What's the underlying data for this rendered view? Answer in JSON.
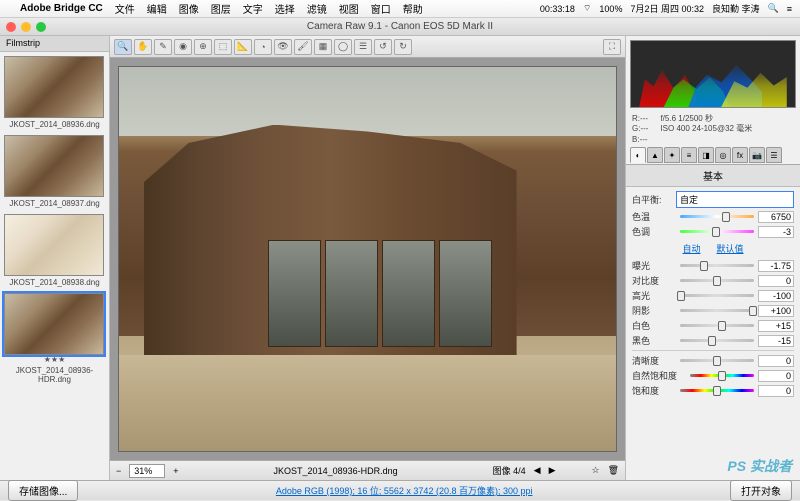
{
  "menubar": {
    "app": "Adobe Bridge CC",
    "items": [
      "文件",
      "编辑",
      "图像",
      "图层",
      "文字",
      "选择",
      "滤镜",
      "视图",
      "窗口",
      "帮助"
    ],
    "right": {
      "progress": "00:33:18",
      "battery": "100%",
      "date": "7月2日 周四 00:32",
      "user": "良知勤 李涛"
    }
  },
  "titlebar": {
    "title": "Camera Raw 9.1 - Canon EOS 5D Mark II"
  },
  "filmstrip": {
    "header": "Filmstrip",
    "thumbs": [
      {
        "label": "JKOST_2014_08936.dng"
      },
      {
        "label": "JKOST_2014_08937.dng"
      },
      {
        "label": "JKOST_2014_08938.dng"
      },
      {
        "label": "JKOST_2014_08936-HDR.dng",
        "stars": "★★★",
        "selected": true
      }
    ]
  },
  "toolbar": {
    "tools": [
      "zoom",
      "hand",
      "eyedrop",
      "sample",
      "crop",
      "straighten",
      "spot",
      "redeye",
      "adjust",
      "brush",
      "grad",
      "radial",
      "prefs",
      "rotate-l",
      "rotate-r"
    ]
  },
  "status": {
    "zoom": "31%",
    "filename": "JKOST_2014_08936-HDR.dng",
    "image_count": "图像 4/4"
  },
  "exif": {
    "r": "---",
    "g": "---",
    "b": "---",
    "aperture": "f/5.6",
    "shutter": "1/2500 秒",
    "iso": "ISO 400",
    "lens": "24-105@32 毫米"
  },
  "basic": {
    "title": "基本",
    "wb_label": "白平衡:",
    "wb_value": "自定",
    "temp_label": "色温",
    "temp_value": "6750",
    "tint_label": "色调",
    "tint_value": "-3",
    "auto": "自动",
    "default": "默认值",
    "exposure_label": "曝光",
    "exposure_value": "-1.75",
    "contrast_label": "对比度",
    "contrast_value": "0",
    "highlights_label": "高光",
    "highlights_value": "-100",
    "shadows_label": "阴影",
    "shadows_value": "+100",
    "whites_label": "白色",
    "whites_value": "+15",
    "blacks_label": "黑色",
    "blacks_value": "-15",
    "clarity_label": "清晰度",
    "clarity_value": "0",
    "vibrance_label": "自然饱和度",
    "vibrance_value": "0",
    "saturation_label": "饱和度",
    "saturation_value": "0"
  },
  "bottom": {
    "save": "存储图像...",
    "info": "Adobe RGB (1998); 16 位; 5562 x 3742 (20.8 百万像素); 300 ppi",
    "done": "打开对象"
  },
  "watermark": "PS 实战者"
}
